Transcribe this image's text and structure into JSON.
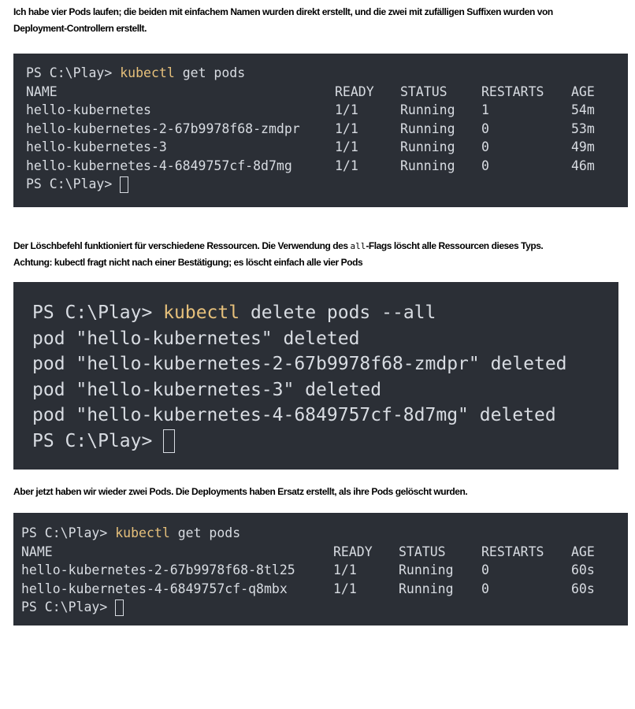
{
  "intro": {
    "line1": "Ich habe vier Pods laufen; die beiden mit einfachem Namen wurden direkt erstellt, und die zwei mit zufälligen Suffixen wurden von",
    "line2": "Deployment-Controllern erstellt."
  },
  "terminal1": {
    "prompt": "PS C:\\Play> ",
    "command_keyword": "kubectl",
    "command_rest": " get pods",
    "headers": {
      "name": "NAME",
      "ready": "READY",
      "status": "STATUS",
      "restarts": "RESTARTS",
      "age": "AGE"
    },
    "rows": [
      {
        "name": "hello-kubernetes",
        "ready": "1/1",
        "status": "Running",
        "restarts": "1",
        "age": "54m"
      },
      {
        "name": "hello-kubernetes-2-67b9978f68-zmdpr",
        "ready": "1/1",
        "status": "Running",
        "restarts": "0",
        "age": "53m"
      },
      {
        "name": "hello-kubernetes-3",
        "ready": "1/1",
        "status": "Running",
        "restarts": "0",
        "age": "49m"
      },
      {
        "name": "hello-kubernetes-4-6849757cf-8d7mg",
        "ready": "1/1",
        "status": "Running",
        "restarts": "0",
        "age": "46m"
      }
    ],
    "final_prompt": "PS C:\\Play> "
  },
  "delete_explanation": {
    "line1_before": "Der Löschbefehl funktioniert für verschiedene Ressourcen. Die Verwendung des ",
    "line1_code": "all",
    "line1_after": "-Flags löscht alle Ressourcen dieses Typs.",
    "line2": "Achtung: kubectl fragt nicht nach einer Bestätigung; es löscht einfach alle vier Pods"
  },
  "terminal2": {
    "prompt": "PS C:\\Play> ",
    "command_keyword": "kubectl",
    "command_rest": " delete pods --all",
    "output": [
      "pod \"hello-kubernetes\" deleted",
      "pod \"hello-kubernetes-2-67b9978f68-zmdpr\" deleted",
      "pod \"hello-kubernetes-3\" deleted",
      "pod \"hello-kubernetes-4-6849757cf-8d7mg\" deleted"
    ],
    "final_prompt": "PS C:\\Play> "
  },
  "result_text": "Aber jetzt haben wir wieder zwei Pods. Die Deployments haben Ersatz erstellt, als ihre Pods gelöscht wurden.",
  "terminal3": {
    "prompt": "PS C:\\Play> ",
    "command_keyword": "kubectl",
    "command_rest": " get pods",
    "headers": {
      "name": "NAME",
      "ready": "READY",
      "status": "STATUS",
      "restarts": "RESTARTS",
      "age": "AGE"
    },
    "rows": [
      {
        "name": "hello-kubernetes-2-67b9978f68-8tl25",
        "ready": "1/1",
        "status": "Running",
        "restarts": "0",
        "age": "60s"
      },
      {
        "name": "hello-kubernetes-4-6849757cf-q8mbx",
        "ready": "1/1",
        "status": "Running",
        "restarts": "0",
        "age": "60s"
      }
    ],
    "final_prompt": "PS C:\\Play> "
  },
  "colors": {
    "terminal_bg": "#2b2f36",
    "terminal_text": "#d8dce2",
    "command_highlight": "#e6c07b"
  }
}
